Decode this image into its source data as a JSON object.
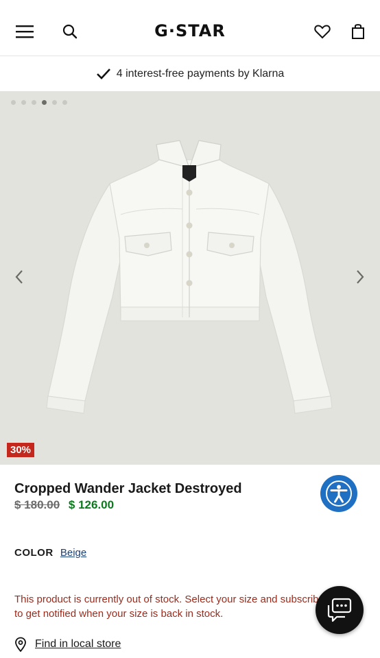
{
  "header": {
    "logo": "G·STAR",
    "icons": [
      "menu-icon",
      "search-icon",
      "heart-icon",
      "shopping-bag-icon"
    ]
  },
  "banner": {
    "text": "4 interest-free payments by Klarna"
  },
  "gallery": {
    "image_count": 6,
    "active_index": 3,
    "discount_badge": "30%"
  },
  "product": {
    "name": "Cropped Wander Jacket Destroyed",
    "original_price": "$ 180.00",
    "sale_price": "$ 126.00",
    "color_label": "COLOR",
    "color_value": "Beige",
    "stock_message": "This product is currently out of stock. Select your size and subscribe to get notified when your size is back in stock.",
    "store_link": "Find in local store"
  },
  "colors": {
    "sale_green": "#0b7a1d",
    "badge_red": "#c4281c",
    "stock_red": "#9a2b1c",
    "accessibility_blue": "#1f6fc2",
    "link_blue": "#1b3f7a"
  }
}
